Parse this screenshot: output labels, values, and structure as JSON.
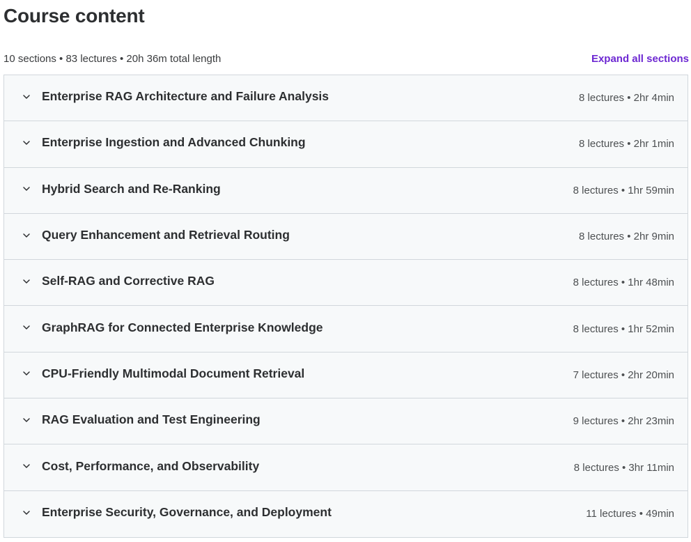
{
  "page": {
    "title": "Course content",
    "summary": "10 sections • 83 lectures • 20h 36m total length",
    "expand_all_label": "Expand all sections",
    "accent_color": "#6d28d2"
  },
  "sections": [
    {
      "title": "Enterprise RAG Architecture and Failure Analysis",
      "meta": "8 lectures • 2hr 4min"
    },
    {
      "title": "Enterprise Ingestion and Advanced Chunking",
      "meta": "8 lectures • 2hr 1min"
    },
    {
      "title": "Hybrid Search and Re-Ranking",
      "meta": "8 lectures • 1hr 59min"
    },
    {
      "title": "Query Enhancement and Retrieval Routing",
      "meta": "8 lectures • 2hr 9min"
    },
    {
      "title": "Self-RAG and Corrective RAG",
      "meta": "8 lectures • 1hr 48min"
    },
    {
      "title": "GraphRAG for Connected Enterprise Knowledge",
      "meta": "8 lectures • 1hr 52min"
    },
    {
      "title": "CPU-Friendly Multimodal Document Retrieval",
      "meta": "7 lectures • 2hr 20min"
    },
    {
      "title": "RAG Evaluation and Test Engineering",
      "meta": "9 lectures • 2hr 23min"
    },
    {
      "title": "Cost, Performance, and Observability",
      "meta": "8 lectures • 3hr 11min"
    },
    {
      "title": "Enterprise Security, Governance, and Deployment",
      "meta": "11 lectures • 49min"
    }
  ],
  "icons": {
    "section_toggle": "chevron-down-icon"
  }
}
